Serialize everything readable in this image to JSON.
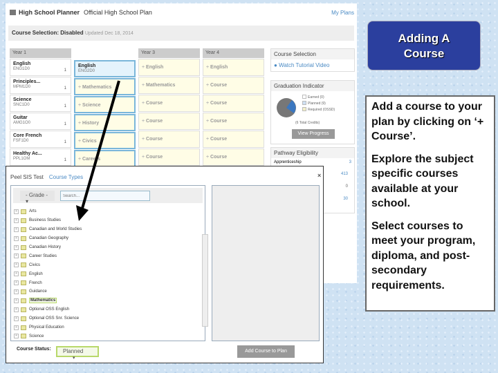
{
  "planner": {
    "title": "High School Planner",
    "subtitle": "Official High School Plan",
    "my_plans": "My Plans",
    "status_label": "Course Selection: Disabled",
    "updated": "Updated Dec 18, 2014",
    "years": [
      "Year 1",
      "Year 2",
      "Year 3",
      "Year 4"
    ],
    "year1": [
      {
        "name": "English",
        "code": "ENG1D0",
        "credit": "1"
      },
      {
        "name": "Principles...",
        "code": "MPM1D0",
        "credit": "1"
      },
      {
        "name": "Science",
        "code": "SNC1D0",
        "credit": "1"
      },
      {
        "name": "Guitar",
        "code": "AMG1O0",
        "credit": "1"
      },
      {
        "name": "Core French",
        "code": "FSF1D0",
        "credit": "1"
      },
      {
        "name": "Healthy Ac...",
        "code": "PPL1OM",
        "credit": "1"
      }
    ],
    "year2": [
      {
        "name": "English",
        "code": "ENG2D0"
      },
      {
        "add": "Mathematics"
      },
      {
        "add": "Science"
      },
      {
        "add": "History"
      },
      {
        "add": "Civics"
      },
      {
        "add": "Careers"
      }
    ],
    "year3": [
      "English",
      "Mathematics",
      "Course",
      "Course",
      "Course",
      "Course"
    ],
    "year4": [
      "English",
      "Course",
      "Course",
      "Course",
      "Course",
      "Course"
    ],
    "sidebar": {
      "course_selection": "Course Selection",
      "tutorial": "Watch Tutorial Video",
      "grad": "Graduation Indicator",
      "earned": "Earned (0)",
      "planned": "Planned (9)",
      "required": "Required (OSSD)",
      "total": "(6 Total Credits)",
      "view_progress": "View Progress",
      "pathway": "Pathway Eligibility",
      "apprenticeship": "Apprenticeship",
      "vals": [
        "3",
        "413",
        "0",
        "30"
      ]
    },
    "colors": {
      "accent": "#3a9ad9",
      "planned": "#3b77c0",
      "earned_pie": "#777777"
    }
  },
  "modal": {
    "tab1": "Peel SIS Test",
    "tab2": "Course Types",
    "grade": "- Grade -",
    "search_placeholder": "Search...",
    "items": [
      "Arts",
      "Business Studies",
      "Canadian and World Studies",
      "Canadian Geography",
      "Canadian History",
      "Career Studies",
      "Civics",
      "English",
      "French",
      "Guidance",
      "Mathematics",
      "Optional OSS English",
      "Optional OSS Snr. Science",
      "Physical Education",
      "Science"
    ],
    "highlighted": "Mathematics",
    "status_label": "Course Status:",
    "status_value": "Planned",
    "add_button": "Add Course to Plan"
  },
  "slide": {
    "title_line1": "Adding A",
    "title_line2": "Course",
    "p1": "Add a course to your plan by clicking on ‘+ Course’.",
    "p2": "Explore the subject specific courses available at your school.",
    "p3": "Select courses to meet your program, diploma, and post-secondary requirements."
  }
}
